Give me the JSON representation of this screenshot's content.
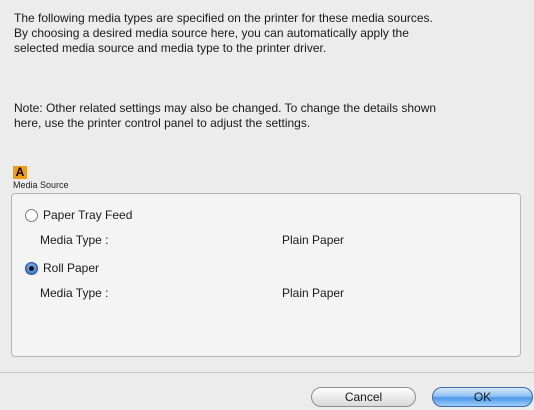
{
  "intro": {
    "line1": "The following media types are specified on the printer for these media sources.",
    "line2": "By choosing a desired media source here, you can automatically apply the",
    "line3": "selected media source and media type to the printer driver."
  },
  "note": {
    "line1": "Note: Other related settings may also be changed. To change the details shown",
    "line2": "here, use the printer control panel to adjust the settings."
  },
  "marker_letter": "A",
  "media_source": {
    "group_label": "Media Source",
    "selected": "Roll Paper",
    "options": [
      {
        "label": "Paper Tray Feed",
        "selected": false,
        "media_type_label": "Media Type :",
        "media_type_value": "Plain Paper"
      },
      {
        "label": "Roll Paper",
        "selected": true,
        "media_type_label": "Media Type :",
        "media_type_value": "Plain Paper"
      }
    ]
  },
  "buttons": {
    "cancel": "Cancel",
    "ok": "OK"
  },
  "colors": {
    "marker": "#f39c12",
    "default_button": "#4d97e8"
  }
}
